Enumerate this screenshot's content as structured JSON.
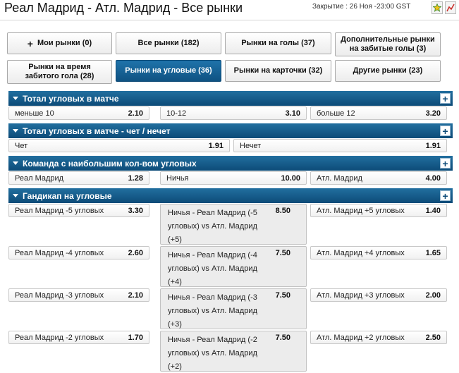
{
  "header": {
    "title": "Реал Мадрид - Атл. Мадрид - Все рынки",
    "closing": "Закрытие : 26 Ноя -23:00 GST",
    "icons": [
      "star-icon",
      "chart-icon"
    ]
  },
  "filters": {
    "my_markets": "Мои рынки (0)",
    "all_markets": "Все рынки (182)",
    "goals_markets": "Рынки на голы (37)",
    "extra_goals_markets": "Дополнительные рынки на забитые голы (3)",
    "goal_time_markets": "Рынки на время забитого гола (28)",
    "corners_markets": "Рынки на угловые (36)",
    "cards_markets": "Рынки на карточки (32)",
    "other_markets": "Другие рынки (23)",
    "active": "corners_markets"
  },
  "sections": {
    "total_corners": {
      "title": "Тотал угловых в матче",
      "odds": [
        {
          "label": "меньше 10",
          "price": "2.10"
        },
        {
          "label": "10-12",
          "price": "3.10"
        },
        {
          "label": "больше 12",
          "price": "3.20"
        }
      ]
    },
    "odd_even_corners": {
      "title": "Тотал угловых в матче - чет / нечет",
      "odds": [
        {
          "label": "Чет",
          "price": "1.91"
        },
        {
          "label": "Нечет",
          "price": "1.91"
        }
      ]
    },
    "most_corners": {
      "title": "Команда с наибольшим кол-вом угловых",
      "odds": [
        {
          "label": "Реал Мадрид",
          "price": "1.28"
        },
        {
          "label": "Ничья",
          "price": "10.00"
        },
        {
          "label": "Атл. Мадрид",
          "price": "4.00"
        }
      ]
    },
    "handicap_corners": {
      "title": "Гандикап на угловые",
      "rows": [
        {
          "home": {
            "label": "Реал Мадрид -5 угловых",
            "price": "3.30"
          },
          "draw": {
            "label": "Ничья - Реал Мадрид (-5 угловых) vs Атл. Мадрид (+5)",
            "price": "8.50"
          },
          "away": {
            "label": "Атл. Мадрид +5 угловых",
            "price": "1.40"
          }
        },
        {
          "home": {
            "label": "Реал Мадрид -4 угловых",
            "price": "2.60"
          },
          "draw": {
            "label": "Ничья - Реал Мадрид (-4 угловых) vs Атл. Мадрид (+4)",
            "price": "7.50"
          },
          "away": {
            "label": "Атл. Мадрид +4 угловых",
            "price": "1.65"
          }
        },
        {
          "home": {
            "label": "Реал Мадрид -3 угловых",
            "price": "2.10"
          },
          "draw": {
            "label": "Ничья - Реал Мадрид (-3 угловых) vs Атл. Мадрид (+3)",
            "price": "7.50"
          },
          "away": {
            "label": "Атл. Мадрид +3 угловых",
            "price": "2.00"
          }
        },
        {
          "home": {
            "label": "Реал Мадрид -2 угловых",
            "price": "1.70"
          },
          "draw": {
            "label": "Ничья - Реал Мадрид (-2 угловых) vs Атл. Мадрид (+2)",
            "price": "7.50"
          },
          "away": {
            "label": "Атл. Мадрид +2 угловых",
            "price": "2.50"
          }
        }
      ]
    }
  },
  "colors": {
    "header_bar": "#0d4b78",
    "active_button": "#13619a"
  }
}
